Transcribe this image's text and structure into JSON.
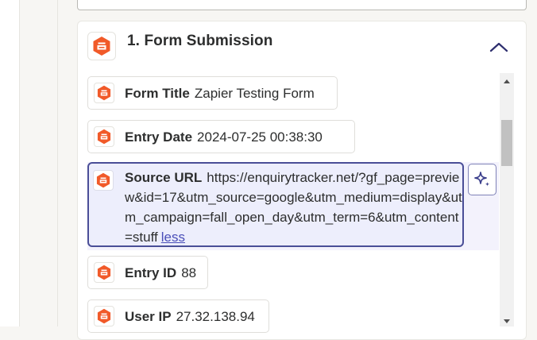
{
  "step": {
    "number": "1.",
    "title": "Form Submission"
  },
  "fields": [
    {
      "label": "Form Title",
      "value": "Zapier Testing Form"
    },
    {
      "label": "Entry Date",
      "value": "2024-07-25 00:38:30"
    },
    {
      "label": "Source URL",
      "value": "https://enquirytracker.net/?gf_page=preview&id=17&utm_source=google&utm_medium=display&utm_campaign=fall_open_day&utm_term=6&utm_content=stuff",
      "toggle": "less"
    },
    {
      "label": "Entry ID",
      "value": "88"
    },
    {
      "label": "User IP",
      "value": "27.32.138.94"
    }
  ],
  "icons": {
    "app": "gravity-forms-icon",
    "collapse": "chevron-up-icon",
    "ai": "sparkle-icon"
  },
  "colors": {
    "brand": "#f15a29",
    "accent": "#4a4e97",
    "selected_bg": "#edeefc"
  }
}
